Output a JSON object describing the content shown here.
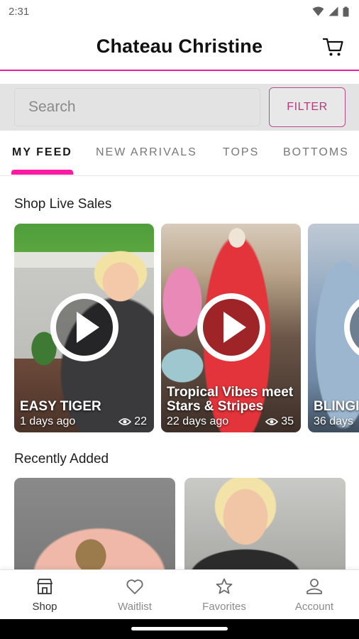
{
  "status_bar": {
    "time": "2:31"
  },
  "header": {
    "title": "Chateau Christine"
  },
  "search": {
    "placeholder": "Search",
    "filter_label": "FILTER"
  },
  "tabs": [
    {
      "label": "MY FEED"
    },
    {
      "label": "NEW ARRIVALS"
    },
    {
      "label": "TOPS"
    },
    {
      "label": "BOTTOMS"
    }
  ],
  "live_sales": {
    "title": "Shop Live Sales",
    "cards": [
      {
        "title": "EASY TIGER",
        "age": "1 days ago",
        "views": "22"
      },
      {
        "title": "Tropical Vibes meet Stars & Stripes",
        "age": "22 days ago",
        "views": "35"
      },
      {
        "title": "BLINGIN' THE DI",
        "age": "36 days",
        "views": ""
      }
    ]
  },
  "recently_added": {
    "title": "Recently Added"
  },
  "nav": [
    {
      "label": "Shop",
      "icon": "shop-icon"
    },
    {
      "label": "Waitlist",
      "icon": "heart-icon"
    },
    {
      "label": "Favorites",
      "icon": "star-icon"
    },
    {
      "label": "Account",
      "icon": "account-icon"
    }
  ],
  "colors": {
    "accent": "#e91e9c",
    "filter_text": "#b23c7c"
  }
}
